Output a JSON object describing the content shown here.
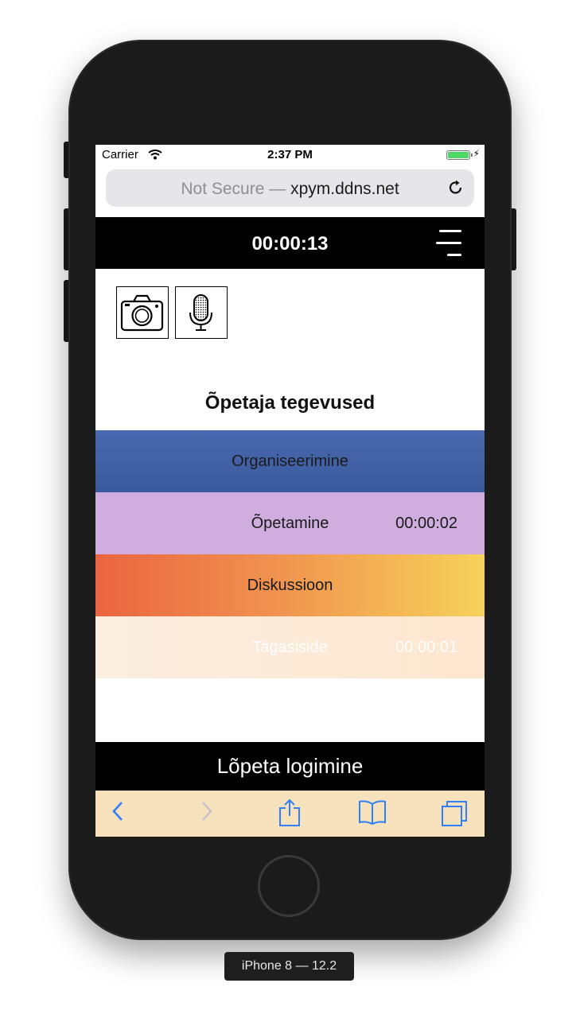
{
  "status_bar": {
    "carrier": "Carrier",
    "time": "2:37 PM",
    "wifi_icon": "wifi-icon",
    "battery_icon": "battery-icon"
  },
  "url_bar": {
    "not_secure": "Not Secure —",
    "domain": "xpym.ddns.net",
    "reload_icon": "reload-icon"
  },
  "app_header": {
    "timer": "00:00:13",
    "menu_icon": "menu-icon"
  },
  "tools": {
    "camera_icon": "camera-icon",
    "microphone_icon": "microphone-icon"
  },
  "section_title": "Õpetaja tegevused",
  "activities": [
    {
      "label": "Organiseerimine",
      "time": ""
    },
    {
      "label": "Õpetamine",
      "time": "00:00:02"
    },
    {
      "label": "Diskussioon",
      "time": ""
    },
    {
      "label": "Tagasiside",
      "time": "00:00:01"
    }
  ],
  "finish_button": "Lõpeta logimine",
  "safari_toolbar": {
    "icons": [
      "back-icon",
      "forward-icon",
      "share-icon",
      "bookmarks-icon",
      "tabs-icon"
    ]
  },
  "device_label": "iPhone 8 — 12.2",
  "colors": {
    "accent_blue": "#3b5a9e",
    "lilac": "#cfaedf",
    "orange": "#ea6541",
    "yellow": "#f6d25a",
    "peach": "#fbeee0",
    "toolbar": "#f8e2bd",
    "ios_blue": "#2f7ff6"
  }
}
